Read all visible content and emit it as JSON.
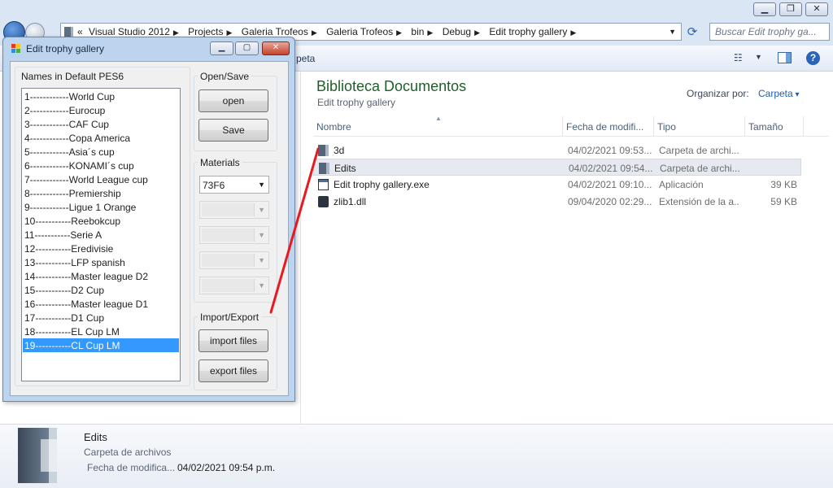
{
  "explorer": {
    "titlebar": {
      "minimize_glyph": "▁",
      "maximize_glyph": "❐",
      "close_glyph": "✕"
    },
    "address": {
      "overflow": "«",
      "crumbs": [
        "Visual Studio 2012",
        "Projects",
        "Galeria Trofeos",
        "Galeria Trofeos",
        "bin",
        "Debug",
        "Edit trophy gallery"
      ],
      "separator": "▶",
      "dropdown_glyph": "▼"
    },
    "refresh_glyph": "⟳",
    "search_placeholder": "Buscar Edit trophy ga...",
    "toolbar": {
      "partial_label": "peta",
      "views_glyph": "☷",
      "viewdrop_glyph": "▼",
      "help_glyph": "?"
    },
    "library": {
      "title": "Biblioteca Documentos",
      "subtitle": "Edit trophy gallery"
    },
    "organize": {
      "label": "Organizar por:",
      "value": "Carpeta"
    },
    "columns": {
      "name": "Nombre",
      "date": "Fecha de modifi...",
      "type": "Tipo",
      "size": "Tamaño",
      "sort_glyph": "▲"
    },
    "files": [
      {
        "name": "3d",
        "date": "04/02/2021 09:53...",
        "type": "Carpeta de archi...",
        "size": "",
        "icon": "folder-icon"
      },
      {
        "name": "Edits",
        "date": "04/02/2021 09:54...",
        "type": "Carpeta de archi...",
        "size": "",
        "icon": "folder-icon"
      },
      {
        "name": "Edit trophy gallery.exe",
        "date": "04/02/2021 09:10...",
        "type": "Aplicación",
        "size": "39 KB",
        "icon": "exe-icon"
      },
      {
        "name": "zlib1.dll",
        "date": "09/04/2020 02:29...",
        "type": "Extensión de la a...",
        "size": "59 KB",
        "icon": "dll-icon"
      }
    ],
    "details": {
      "name": "Edits",
      "type": "Carpeta de archivos",
      "modified_label": "Fecha de modifica...",
      "modified_value": "04/02/2021 09:54 p.m."
    }
  },
  "dialog": {
    "title": "Edit trophy gallery",
    "caption": {
      "minimize_glyph": "▁",
      "maximize_glyph": "▢",
      "close_glyph": "✕"
    },
    "names_label": "Names in Default PES6",
    "names": [
      "1------------World Cup",
      "2------------Eurocup",
      "3------------CAF Cup",
      "4------------Copa America",
      "5------------Asia´s cup",
      "6------------KONAMI´s cup",
      "7------------World League cup",
      "8------------Premiership",
      "9------------Ligue 1 Orange",
      "10-----------Reebokcup",
      "11-----------Serie A",
      "12-----------Eredivisie",
      "13-----------LFP spanish",
      "14-----------Master league D2",
      "15-----------D2 Cup",
      "16-----------Master league D1",
      "17-----------D1 Cup",
      "18-----------EL Cup LM",
      "19-----------CL Cup LM"
    ],
    "selected_index": 18,
    "open_save": {
      "label": "Open/Save",
      "open_button": "open",
      "save_button": "Save"
    },
    "materials": {
      "label": "Materials",
      "selected": "73F6",
      "dropdown_glyph": "▼"
    },
    "import_export": {
      "label": "Import/Export",
      "import_button": "import files",
      "export_button": "export files"
    }
  },
  "colors": {
    "library_title": "#1e5f28",
    "selection": "#3399ff",
    "annotation_line": "#e8191f",
    "link": "#1f5fb2"
  }
}
